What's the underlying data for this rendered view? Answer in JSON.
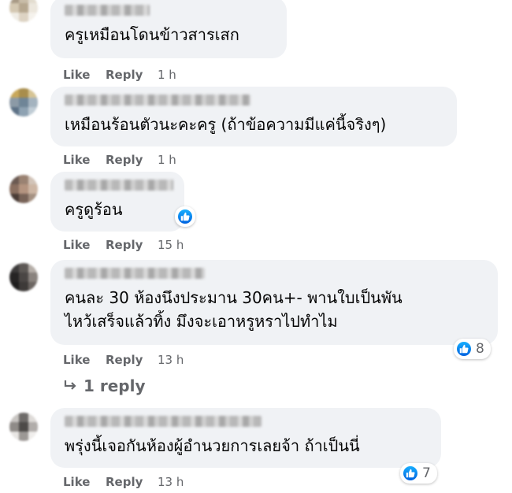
{
  "comments": [
    {
      "text_lines": [
        "ครูเหมือนโดนข้าวสารเสก"
      ],
      "like_label": "Like",
      "reply_label": "Reply",
      "time": "1 h"
    },
    {
      "text_lines": [
        "เหมือนร้อนตัวนะคะครู (ถ้าข้อความมีแค่นี้จริงๆ)"
      ],
      "like_label": "Like",
      "reply_label": "Reply",
      "time": "1 h"
    },
    {
      "text_lines": [
        "ครูดูร้อน"
      ],
      "like_label": "Like",
      "reply_label": "Reply",
      "time": "15 h",
      "reaction_icon": "like-icon"
    },
    {
      "text_lines": [
        "คนละ 30 ห้องนึงประมาน 30คน+- พานใบเป็นพัน",
        "ไหว้เสร็จแล้วทิ้ง มึงจะเอาหรูหราไปทำไม"
      ],
      "like_label": "Like",
      "reply_label": "Reply",
      "time": "13 h",
      "reaction_icon": "like-icon",
      "reaction_count": "8",
      "replies_label": "1 reply"
    },
    {
      "text_lines": [
        "พรุ่งนี้เจอกันห้องผู้อำนวยการเลยจ้า ถ้าเป็นนี่"
      ],
      "like_label": "Like",
      "reply_label": "Reply",
      "time": "13 h",
      "reaction_icon": "like-icon",
      "reaction_count": "7"
    }
  ],
  "colors": {
    "bubble": "#f0f2f5",
    "meta_text": "#65676b",
    "like_blue": "#1877f2"
  }
}
